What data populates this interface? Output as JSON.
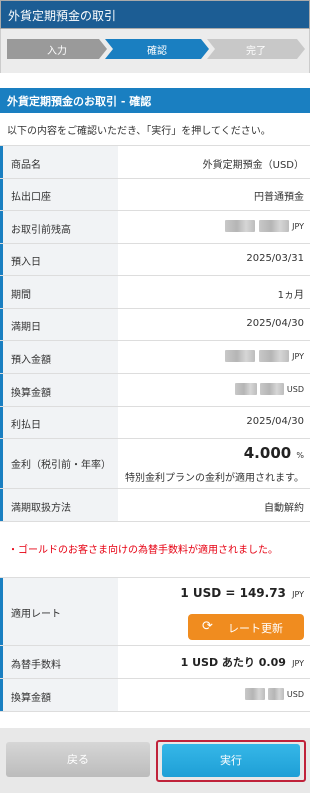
{
  "header": {
    "title": "外貨定期預金の取引"
  },
  "steps": [
    {
      "label": "入力",
      "state": "done"
    },
    {
      "label": "確認",
      "state": "current"
    },
    {
      "label": "完了",
      "state": "todo"
    }
  ],
  "section": {
    "title": "外貨定期預金のお取引 - 確認"
  },
  "intro": "以下の内容をご確認いただき、「実行」を押してください。",
  "rows": {
    "product": {
      "label": "商品名",
      "value": "外貨定期預金（USD）"
    },
    "account": {
      "label": "払出口座",
      "value": "円普通預金"
    },
    "balance": {
      "label": "お取引前残高",
      "unit": "JPY"
    },
    "deposit_date": {
      "label": "預入日",
      "value": "2025/03/31"
    },
    "term": {
      "label": "期間",
      "value": "1ヵ月"
    },
    "maturity": {
      "label": "満期日",
      "value": "2025/04/30"
    },
    "amount": {
      "label": "預入金額",
      "unit": "JPY"
    },
    "converted": {
      "label": "換算金額",
      "unit": "USD"
    },
    "interest_date": {
      "label": "利払日",
      "value": "2025/04/30"
    },
    "rate": {
      "label": "金利（税引前・年率）",
      "value": "4.000",
      "unit": "%",
      "note": "特別金利プランの金利が適用されます。"
    },
    "maturity_handling": {
      "label": "満期取扱方法",
      "value": "自動解約"
    }
  },
  "notice": "・ゴールドのお客さま向けの為替手数料が適用されました。",
  "fx": {
    "label": "適用レート",
    "rate_text": "1 USD = 149.73",
    "rate_unit": "JPY",
    "update_button": "レート更新"
  },
  "fee": {
    "label": "為替手数料",
    "value": "1 USD あたり 0.09",
    "unit": "JPY"
  },
  "converted2": {
    "label": "換算金額",
    "unit": "USD"
  },
  "buttons": {
    "back": "戻る",
    "execute": "実行"
  },
  "colors": {
    "primary": "#1a7fc1",
    "accent_orange": "#f08c1f",
    "alert_red": "#e60012"
  }
}
